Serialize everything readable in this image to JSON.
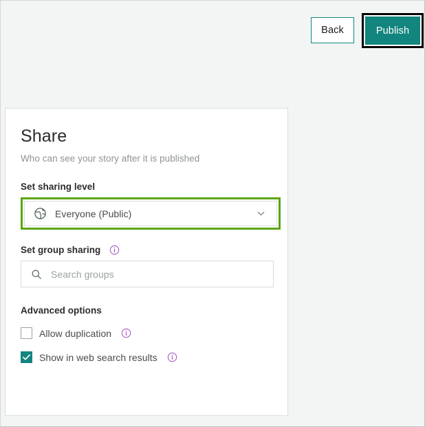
{
  "toolbar": {
    "back_label": "Back",
    "publish_label": "Publish"
  },
  "panel": {
    "title": "Share",
    "subtitle": "Who can see your story after it is published",
    "sharing_level": {
      "label": "Set sharing level",
      "selected": "Everyone (Public)",
      "icon": "globe-icon",
      "chevron": "chevron-down-icon"
    },
    "group_sharing": {
      "label": "Set group sharing",
      "info": "info-icon",
      "search_placeholder": "Search groups",
      "search_value": "",
      "search_icon": "search-icon"
    },
    "advanced": {
      "label": "Advanced options",
      "options": [
        {
          "label": "Allow duplication",
          "checked": false,
          "info": "info-icon"
        },
        {
          "label": "Show in web search results",
          "checked": true,
          "info": "info-icon"
        }
      ]
    }
  },
  "colors": {
    "brand_teal": "#12857e",
    "focus_green": "#5aa513",
    "info_purple": "#a855c4",
    "page_bg": "#f2f5f4",
    "panel_bg": "#ffffff",
    "text_dark": "#2b2b2b",
    "text_muted": "#8d9492",
    "focus_black": "#000000"
  }
}
